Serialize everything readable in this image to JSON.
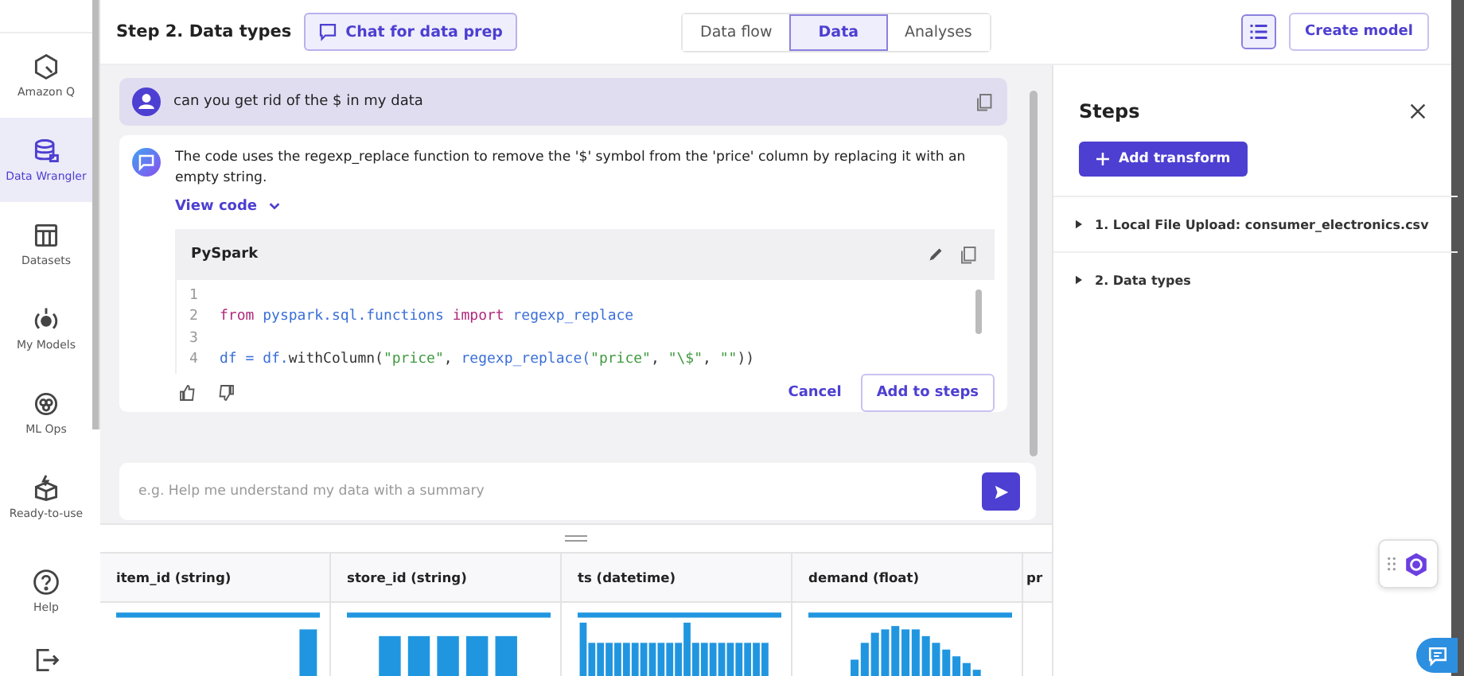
{
  "sidebar": {
    "items": [
      {
        "label": "Amazon Q",
        "selected": false
      },
      {
        "label": "Data Wrangler",
        "selected": true
      },
      {
        "label": "Datasets",
        "selected": false
      },
      {
        "label": "My Models",
        "selected": false
      },
      {
        "label": "ML Ops",
        "selected": false
      },
      {
        "label": "Ready-to-use",
        "selected": false
      },
      {
        "label": "Help",
        "selected": false
      }
    ]
  },
  "header": {
    "title": "Step 2. Data types",
    "chat_button": "Chat for data prep",
    "tabs": [
      {
        "label": "Data flow",
        "selected": false
      },
      {
        "label": "Data",
        "selected": true
      },
      {
        "label": "Analyses",
        "selected": false
      }
    ],
    "create_button": "Create model"
  },
  "chat": {
    "user_message": "can you get rid of the $ in my data",
    "reply": "The code uses the regexp_replace function to remove the '$' symbol from the 'price' column by replacing it with an empty string.",
    "view_code": "View code",
    "code_block": {
      "language": "PySpark",
      "lines": [
        {
          "number": "1"
        },
        {
          "number": "2",
          "tokens": [
            {
              "kind": "keyword",
              "text": "from"
            },
            {
              "kind": "ident",
              "text": " pyspark.sql.functions "
            },
            {
              "kind": "keyword",
              "text": "import"
            },
            {
              "kind": "ident",
              "text": " regexp_replace"
            }
          ]
        },
        {
          "number": "3"
        },
        {
          "number": "4",
          "tokens": [
            {
              "kind": "ident",
              "text": "df = df."
            },
            {
              "kind": "plain",
              "text": "withColumn("
            },
            {
              "kind": "string",
              "text": "\"price\""
            },
            {
              "kind": "plain",
              "text": ", "
            },
            {
              "kind": "ident",
              "text": "regexp_replace("
            },
            {
              "kind": "string",
              "text": "\"price\""
            },
            {
              "kind": "plain",
              "text": ", "
            },
            {
              "kind": "string",
              "text": "\"\\$\""
            },
            {
              "kind": "plain",
              "text": ", "
            },
            {
              "kind": "string",
              "text": "\"\""
            },
            {
              "kind": "plain",
              "text": "))"
            }
          ]
        }
      ]
    },
    "cancel": "Cancel",
    "add_button": "Add to steps",
    "input": {
      "placeholder": "e.g. Help me understand my data with a summary"
    }
  },
  "table": {
    "columns": [
      "item_id (string)",
      "store_id (string)",
      "ts (datetime)",
      "demand (float)",
      "pr"
    ]
  },
  "steps_panel": {
    "title": "Steps",
    "add_button": "Add transform",
    "steps": [
      {
        "label": "1. Local File Upload: consumer_electronics.csv",
        "expanded": false
      },
      {
        "label": "2. Data types",
        "expanded": false
      }
    ]
  }
}
